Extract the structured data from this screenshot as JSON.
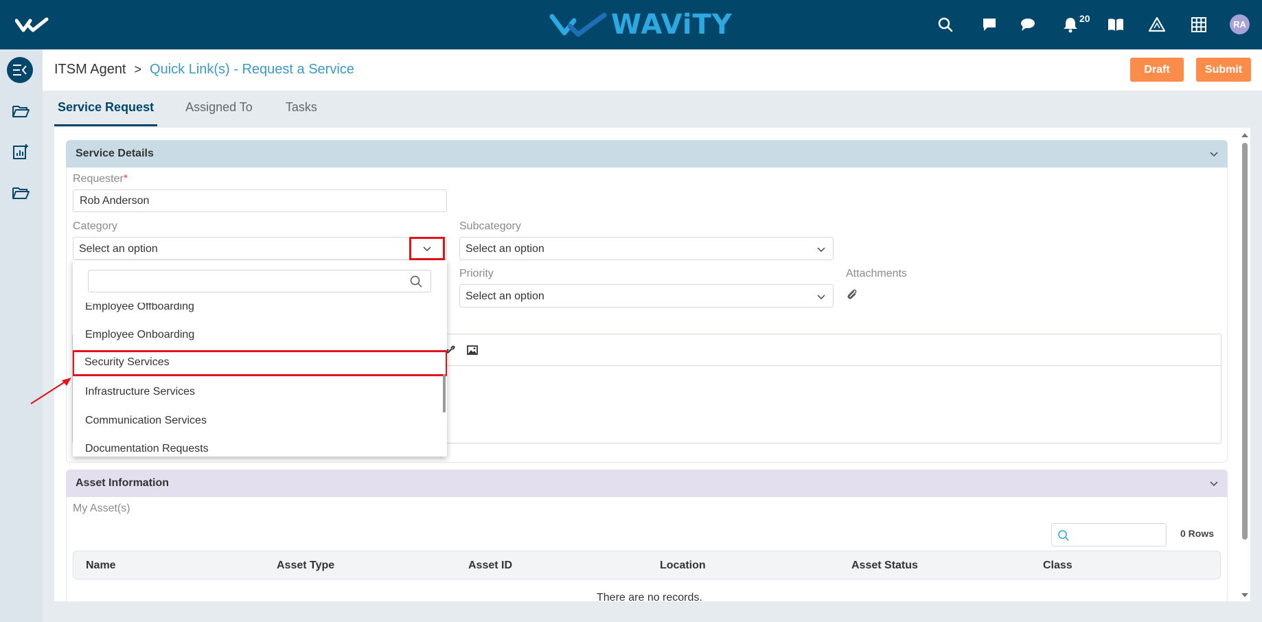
{
  "app": {
    "brand": "WAViTY",
    "avatar_initials": "RA",
    "notification_count": "20"
  },
  "breadcrumb": {
    "root": "ITSM Agent",
    "separator": ">",
    "current": "Quick Link(s) - Request a Service"
  },
  "actions": {
    "draft": "Draft",
    "submit": "Submit"
  },
  "tabs": [
    {
      "label": "Service Request",
      "active": true
    },
    {
      "label": "Assigned To",
      "active": false
    },
    {
      "label": "Tasks",
      "active": false
    }
  ],
  "service_details": {
    "title": "Service Details",
    "requester_label": "Requester",
    "required_mark": "*",
    "requester_value": "Rob Anderson",
    "category_label": "Category",
    "category_value": "Select an option",
    "subcategory_label": "Subcategory",
    "subcategory_value": "Select an option",
    "priority_label": "Priority",
    "priority_value": "Select an option",
    "attachments_label": "Attachments"
  },
  "category_dropdown": {
    "search_placeholder": "",
    "items": [
      {
        "label": "Employee Offboarding",
        "selected": false
      },
      {
        "label": "Employee Onboarding",
        "selected": false
      },
      {
        "label": "Security Services",
        "selected": true
      },
      {
        "label": "Infrastructure Services",
        "selected": false
      },
      {
        "label": "Communication Services",
        "selected": false
      },
      {
        "label": "Documentation Requests",
        "selected": false
      }
    ]
  },
  "asset_information": {
    "title": "Asset Information",
    "my_assets_label": "My Asset(s)",
    "search_placeholder": "",
    "rows_count": "0 Rows",
    "columns": [
      "Name",
      "Asset Type",
      "Asset ID",
      "Location",
      "Asset Status",
      "Class"
    ],
    "empty_text": "There are no records."
  },
  "colors": {
    "topbar": "#02466a",
    "accent_orange": "#fb8c4a",
    "link_blue": "#3a9ac6",
    "highlight_red": "#e3121b",
    "service_header": "#c9dce5",
    "asset_header": "#e3dfee"
  },
  "icons": {
    "topbar": [
      "search-icon",
      "chat-square-icon",
      "chat-bubble-icon",
      "bell-icon",
      "book-icon",
      "hazard-triangle-icon",
      "grid-icon"
    ],
    "rail": [
      "menu-collapse-icon",
      "folder-open-icon",
      "report-add-icon",
      "folder-open-icon"
    ]
  }
}
